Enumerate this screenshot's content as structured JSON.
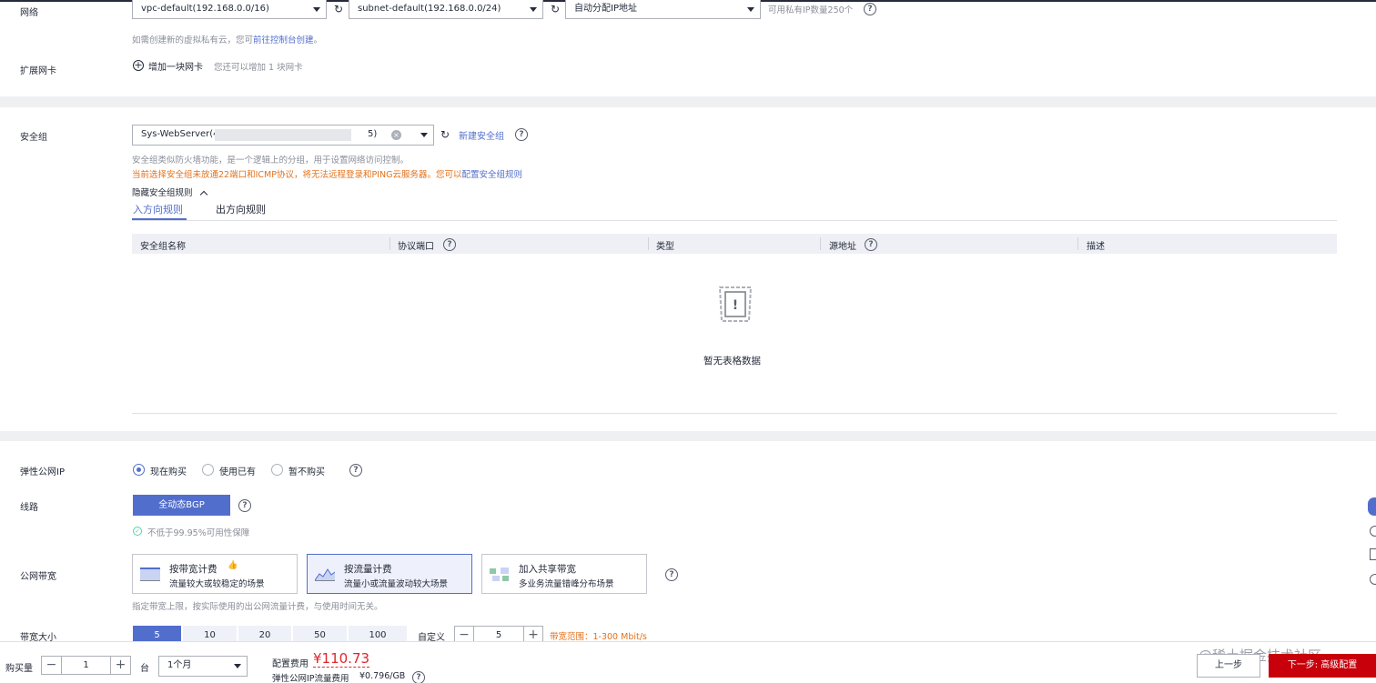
{
  "network": {
    "label": "网络",
    "vpc_value": "vpc-default(192.168.0.0/16)",
    "subnet_value": "subnet-default(192.168.0.0/24)",
    "ip_value": "自动分配IP地址",
    "available_ip": "可用私有IP数量250个",
    "hint_prefix": "如需创建新的虚拟私有云，您可",
    "hint_link": "前往控制台创建",
    "hint_suffix": "。"
  },
  "nic": {
    "label": "扩展网卡",
    "add_label": "增加一块网卡",
    "remaining": "您还可以增加 1 块网卡"
  },
  "security_group": {
    "label": "安全组",
    "value": "Sys-WebServer(4",
    "value_tail": "5)",
    "new_link": "新建安全组",
    "desc": "安全组类似防火墙功能，是一个逻辑上的分组，用于设置网络访问控制。",
    "warning_text": "当前选择安全组未放通22端口和ICMP协议，将无法远程登录和PING云服务器。您可以",
    "warning_link": "配置安全组规则",
    "toggle_label": "隐藏安全组规则",
    "tabs": [
      "入方向规则",
      "出方向规则"
    ],
    "columns": [
      "安全组名称",
      "协议端口",
      "类型",
      "源地址",
      "描述"
    ],
    "empty_text": "暂无表格数据"
  },
  "eip": {
    "label": "弹性公网IP",
    "options": [
      "现在购买",
      "使用已有",
      "暂不购买"
    ],
    "selected": 0
  },
  "line": {
    "label": "线路",
    "button": "全动态BGP",
    "guarantee": "不低于99.95%可用性保障"
  },
  "bandwidth": {
    "label": "公网带宽",
    "cards": [
      {
        "title": "按带宽计费",
        "desc": "流量较大或较稳定的场景",
        "icon": "bandwidth-chart-icon"
      },
      {
        "title": "按流量计费",
        "desc": "流量小或流量波动较大场景",
        "icon": "traffic-chart-icon"
      },
      {
        "title": "加入共享带宽",
        "desc": "多业务流量错峰分布场景",
        "icon": "shared-bandwidth-icon"
      }
    ],
    "selected": 1,
    "note": "指定带宽上限，按实际使用的出公网流量计费，与使用时间无关。"
  },
  "bandwidth_size": {
    "label": "带宽大小",
    "options": [
      "5",
      "10",
      "20",
      "50",
      "100"
    ],
    "selected": 0,
    "custom_label": "自定义",
    "custom_value": "5",
    "range": "带宽范围：1-300 Mbit/s"
  },
  "footer": {
    "qty_label": "购买量",
    "qty_value": "1",
    "unit": "台",
    "duration": "1个月",
    "price_label": "配置费用",
    "price": "¥110.73",
    "traffic_label": "弹性公网IP流量费用",
    "traffic_price": "¥0.796/GB",
    "prev_button": "上一步",
    "next_button": "下一步: 高级配置",
    "watermark": "@稀土掘金技术社区"
  },
  "colors": {
    "primary": "#526ecc",
    "warning": "#e3711b",
    "price": "#e0272c",
    "next_button": "#c7000b"
  }
}
